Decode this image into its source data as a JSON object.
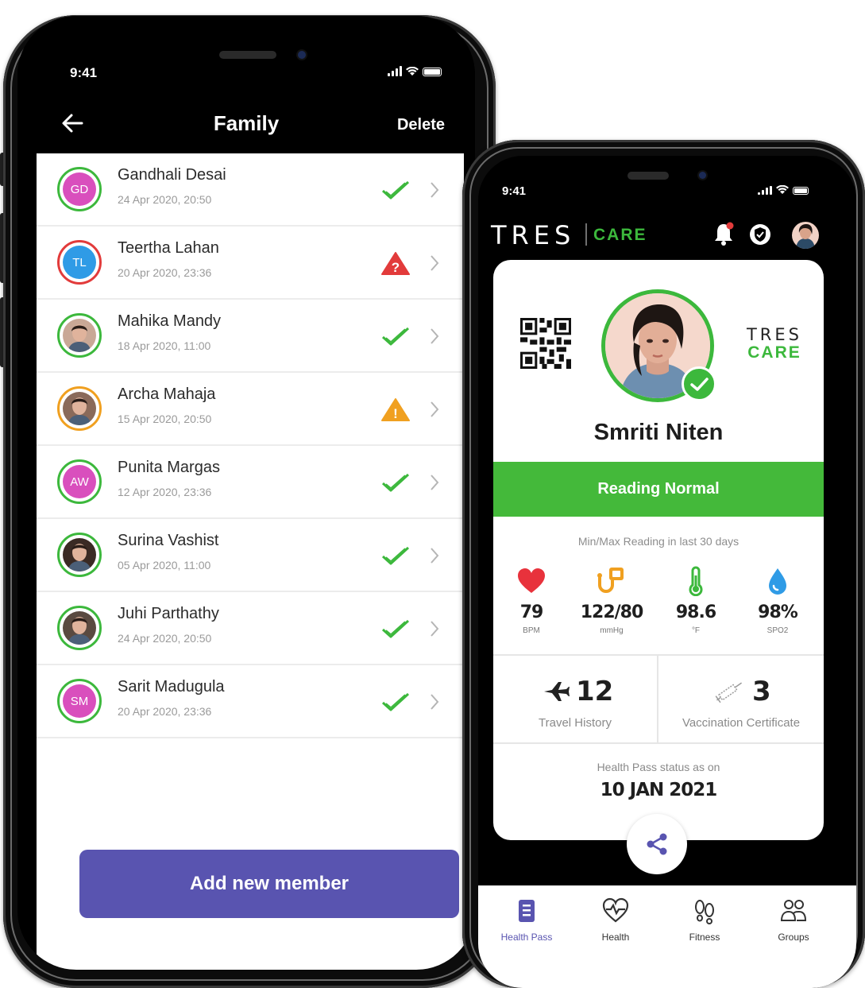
{
  "left_phone": {
    "status_time": "9:41",
    "header": {
      "title": "Family",
      "action_label": "Delete"
    },
    "members": [
      {
        "name": "Gandhali Desai",
        "date": "24 Apr 2020, 20:50",
        "initials": "GD",
        "avatar_color": "#d94fbd",
        "ring_color": "#3cb83c",
        "status": "ok"
      },
      {
        "name": "Teertha Lahan",
        "date": "20 Apr 2020, 23:36",
        "initials": "TL",
        "avatar_color": "#2f9be6",
        "ring_color": "#e23b3b",
        "status": "alert-red"
      },
      {
        "name": "Mahika Mandy",
        "date": "18 Apr 2020, 11:00",
        "initials": "",
        "avatar_color": "#c9a896",
        "ring_color": "#3cb83c",
        "status": "ok"
      },
      {
        "name": "Archa Mahaja",
        "date": "15 Apr 2020, 20:50",
        "initials": "",
        "avatar_color": "#8a6a5a",
        "ring_color": "#f0a020",
        "status": "warning-orange"
      },
      {
        "name": "Punita Margas",
        "date": "12 Apr 2020, 23:36",
        "initials": "AW",
        "avatar_color": "#d94fbd",
        "ring_color": "#3cb83c",
        "status": "ok"
      },
      {
        "name": "Surina Vashist",
        "date": "05 Apr 2020, 11:00",
        "initials": "",
        "avatar_color": "#3a2a24",
        "ring_color": "#3cb83c",
        "status": "ok"
      },
      {
        "name": "Juhi Parthathy",
        "date": "24 Apr 2020, 20:50",
        "initials": "",
        "avatar_color": "#5a4a40",
        "ring_color": "#3cb83c",
        "status": "ok"
      },
      {
        "name": "Sarit Madugula",
        "date": "20 Apr 2020, 23:36",
        "initials": "SM",
        "avatar_color": "#d94fbd",
        "ring_color": "#3cb83c",
        "status": "ok"
      }
    ],
    "add_button_label": "Add new member"
  },
  "right_phone": {
    "status_time": "9:41",
    "brand": {
      "tres": "TRES",
      "care": "CARE"
    },
    "card": {
      "logo_tres": "TRES",
      "logo_care": "CARE",
      "person_name": "Smriti Niten",
      "reading_status": "Reading Normal",
      "minmax_caption": "Min/Max Reading in last 30 days",
      "vitals": [
        {
          "value": "79",
          "unit": "BPM"
        },
        {
          "value": "122/80",
          "unit": "mmHg"
        },
        {
          "value": "98.6",
          "unit": "°F"
        },
        {
          "value": "98%",
          "unit": "SPO2"
        }
      ],
      "travel": {
        "count": "12",
        "label": "Travel History"
      },
      "vaccination": {
        "count": "3",
        "label": "Vaccination Certificate"
      },
      "pass_caption": "Health Pass status as on",
      "pass_date": "10 JAN 2021"
    },
    "tabs": [
      {
        "label": "Health Pass",
        "active": true
      },
      {
        "label": "Health",
        "active": false
      },
      {
        "label": "Fitness",
        "active": false
      },
      {
        "label": "Groups",
        "active": false
      }
    ]
  },
  "colors": {
    "accent_purple": "#5954b0",
    "ok_green": "#3cb83c",
    "alert_red": "#e23b3b",
    "warning_orange": "#f0a020",
    "heart_red": "#e8323c",
    "bp_orange": "#f0a020",
    "temp_green": "#3cb83c",
    "spo2_blue": "#2f9be6"
  }
}
